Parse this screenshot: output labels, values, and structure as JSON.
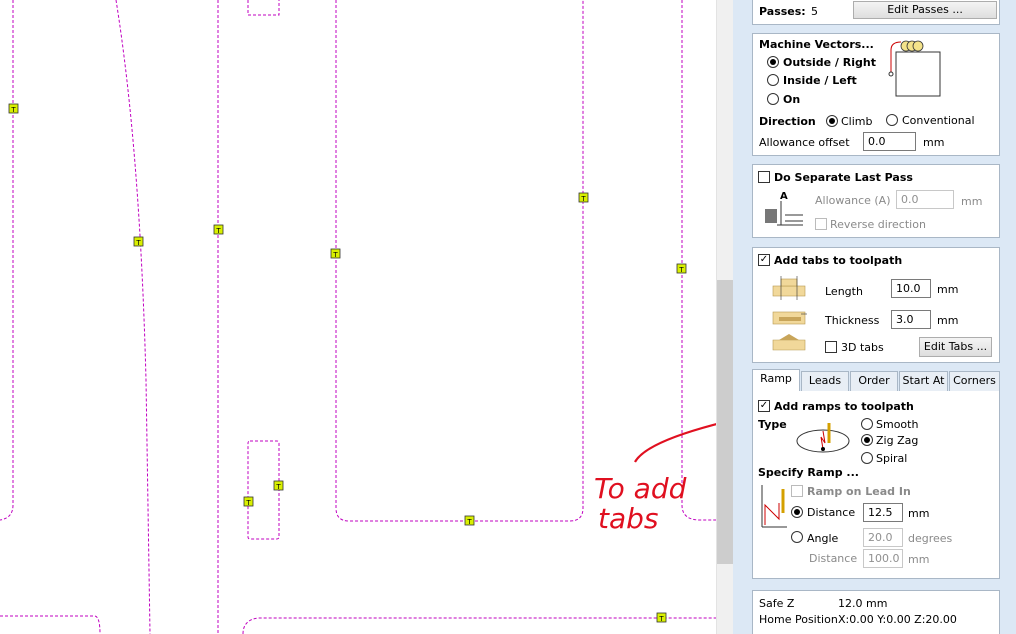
{
  "canvas": {
    "tab_marker": "T",
    "annotation_line1": "To add",
    "annotation_line2": "tabs"
  },
  "passes": {
    "label": "Passes:",
    "value": "5",
    "edit_button": "Edit Passes ..."
  },
  "machine_vectors": {
    "title": "Machine Vectors...",
    "outside": "Outside / Right",
    "inside": "Inside / Left",
    "on": "On",
    "direction_label": "Direction",
    "climb": "Climb",
    "conventional": "Conventional",
    "allowance_label": "Allowance offset",
    "allowance_value": "0.0",
    "allowance_unit": "mm"
  },
  "separate_pass": {
    "title": "Do Separate Last Pass",
    "allowance_label": "Allowance (A)",
    "allowance_value": "0.0",
    "allowance_unit": "mm",
    "reverse_label": "Reverse direction",
    "diagram_letter": "A"
  },
  "tabs": {
    "title": "Add tabs to toolpath",
    "length_label": "Length",
    "length_value": "10.0",
    "length_unit": "mm",
    "thickness_label": "Thickness",
    "thickness_value": "3.0",
    "thickness_unit": "mm",
    "tabs3d_label": "3D tabs",
    "edit_button": "Edit Tabs ..."
  },
  "tab_strip": [
    "Ramp",
    "Leads",
    "Order",
    "Start At",
    "Corners"
  ],
  "ramp": {
    "title": "Add ramps to toolpath",
    "type_label": "Type",
    "smooth": "Smooth",
    "zigzag": "Zig Zag",
    "spiral": "Spiral",
    "specify_label": "Specify Ramp ...",
    "lead_in_label": "Ramp on Lead In",
    "distance_label": "Distance",
    "distance_value": "12.5",
    "distance_unit": "mm",
    "angle_label": "Angle",
    "angle_value": "20.0",
    "angle_unit": "degrees",
    "distance2_label": "Distance",
    "distance2_value": "100.0",
    "distance2_unit": "mm"
  },
  "footer": {
    "safe_z_label": "Safe Z",
    "safe_z_value": "12.0 mm",
    "home_label": "Home Position",
    "home_value": "X:0.00 Y:0.00 Z:20.00"
  },
  "colors": {
    "path": "#c000c0",
    "tab_marker": "#d9f000",
    "annotation": "#e01020",
    "panel_bg": "#dce8f5"
  }
}
